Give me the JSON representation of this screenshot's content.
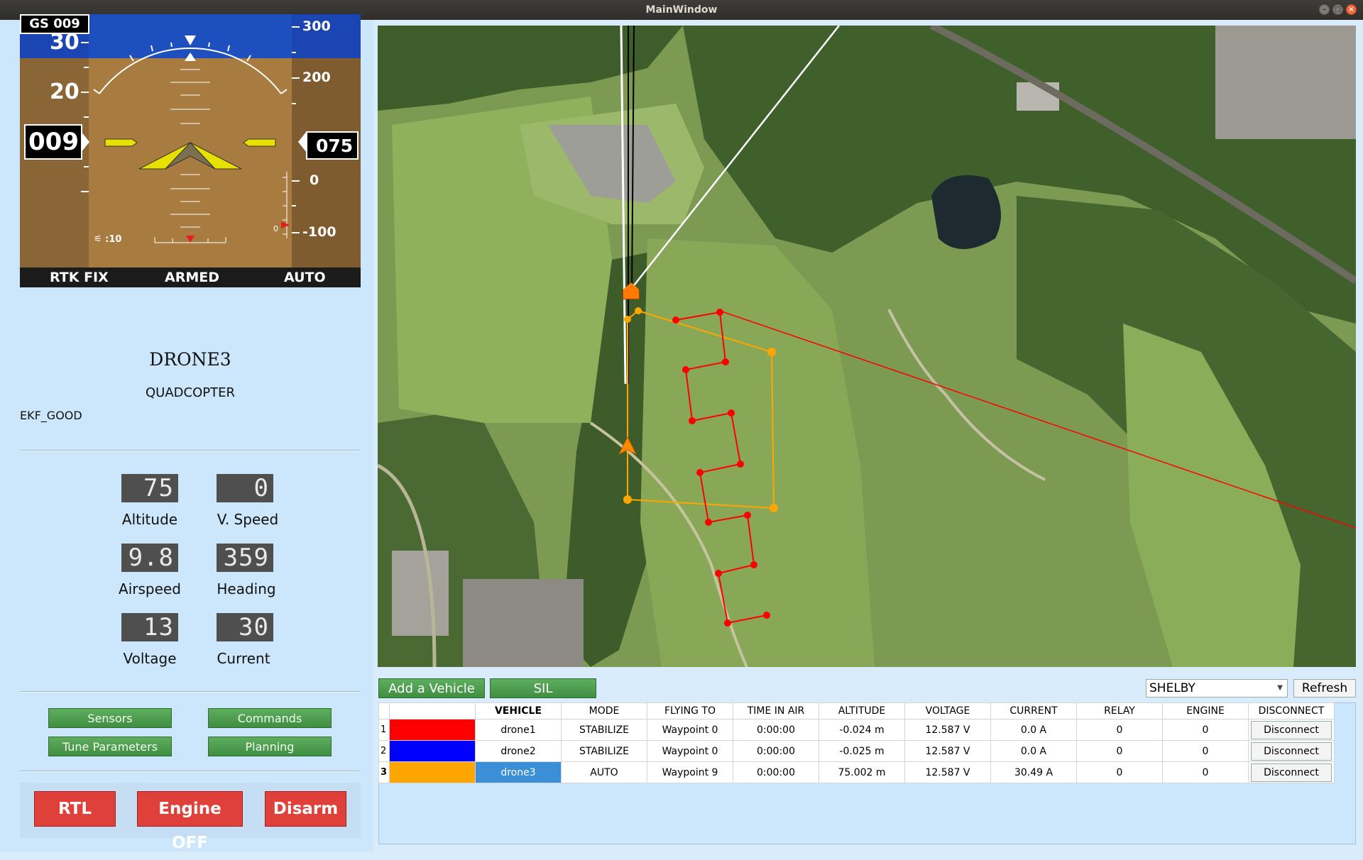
{
  "window": {
    "title": "MainWindow"
  },
  "pfd": {
    "gs_label": "GS 009",
    "speed_ticks": [
      "30",
      "20"
    ],
    "speed_value": "009",
    "alt_ticks": [
      "300",
      "200",
      "0",
      "-100"
    ],
    "alt_value": "075",
    "sat_count": "10",
    "vspeed_readout": "0",
    "status_left": "RTK FIX",
    "status_mid": "ARMED",
    "status_right": "AUTO"
  },
  "vehicle": {
    "name": "DRONE3",
    "type": "QUADCOPTER",
    "ekf": "EKF_GOOD",
    "state": "ACTIVE"
  },
  "telemetry": {
    "altitude": {
      "label": "Altitude",
      "value": "75"
    },
    "vspeed": {
      "label": "V. Speed",
      "value": "0"
    },
    "airspeed": {
      "label": "Airspeed",
      "value": "9.8"
    },
    "heading": {
      "label": "Heading",
      "value": "359"
    },
    "voltage": {
      "label": "Voltage",
      "value": "13"
    },
    "current": {
      "label": "Current",
      "value": "30"
    }
  },
  "panel_buttons": {
    "sensors": "Sensors",
    "commands": "Commands",
    "tune": "Tune  Parameters",
    "planning": "Planning"
  },
  "actions": {
    "rtl": "RTL",
    "engine_off": "Engine  OFF",
    "disarm": "Disarm"
  },
  "toolbar": {
    "add_vehicle": "Add  a  Vehicle",
    "sil": "SIL",
    "location": "SHELBY",
    "refresh": "Refresh"
  },
  "table": {
    "headers": [
      "",
      "VEHICLE",
      "MODE",
      "FLYING TO",
      "TIME IN AIR",
      "ALTITUDE",
      "VOLTAGE",
      "CURRENT",
      "RELAY",
      "ENGINE",
      "DISCONNECT"
    ],
    "rows": [
      {
        "num": "1",
        "color": "#ff0000",
        "vehicle": "drone1",
        "mode": "STABILIZE",
        "flying_to": "Waypoint 0",
        "time": "0:00:00",
        "altitude": "-0.024 m",
        "voltage": "12.587 V",
        "current": "0.0 A",
        "relay": "0",
        "engine": "0",
        "disconnect": "Disconnect"
      },
      {
        "num": "2",
        "color": "#0000ff",
        "vehicle": "drone2",
        "mode": "STABILIZE",
        "flying_to": "Waypoint 0",
        "time": "0:00:00",
        "altitude": "-0.025 m",
        "voltage": "12.587 V",
        "current": "0.0 A",
        "relay": "0",
        "engine": "0",
        "disconnect": "Disconnect"
      },
      {
        "num": "3",
        "color": "#ffa500",
        "vehicle": "drone3",
        "mode": "AUTO",
        "flying_to": "Waypoint 9",
        "time": "0:00:00",
        "altitude": "75.002 m",
        "voltage": "12.587 V",
        "current": "30.49 A",
        "relay": "0",
        "engine": "0",
        "disconnect": "Disconnect"
      }
    ]
  },
  "colors": {
    "accent_green": "#4f9f50",
    "danger_red": "#e0403a",
    "selection_blue": "#3a8fd6",
    "drone3_path": "#ffa500",
    "survey_path": "#ff0000"
  }
}
